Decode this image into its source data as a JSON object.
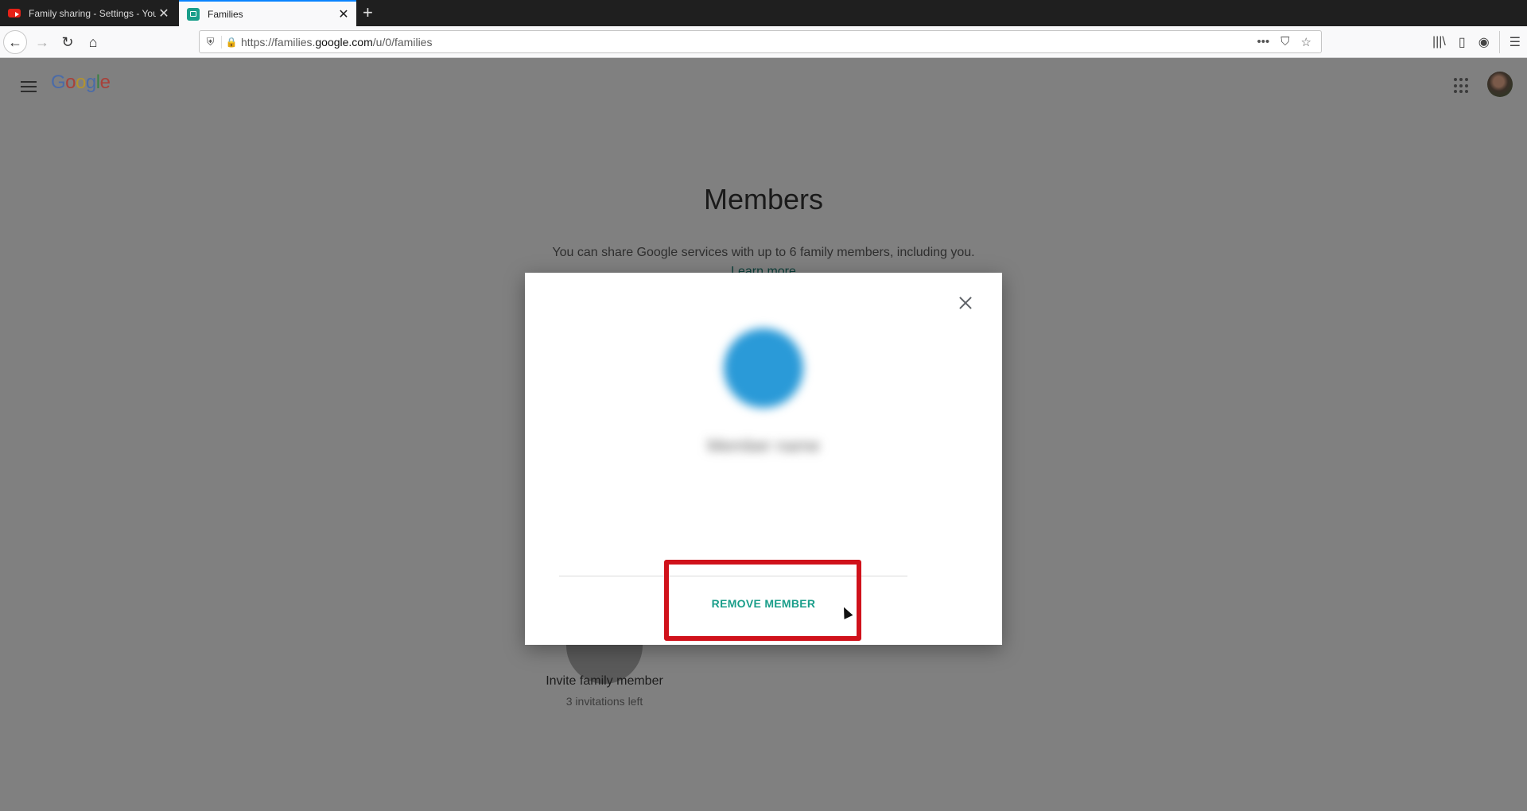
{
  "browser": {
    "tabs": [
      {
        "title": "Family sharing - Settings - YouTube",
        "favicon": "youtube-icon",
        "active": false
      },
      {
        "title": "Families",
        "favicon": "families-icon",
        "active": true
      }
    ],
    "new_tab_label": "+",
    "close_label": "✕",
    "url": {
      "prefix": "https://families.",
      "domain": "google.com",
      "path": "/u/0/families"
    },
    "nav": {
      "back": "←",
      "forward": "→",
      "reload": "↻",
      "home": "⌂"
    },
    "url_actions": {
      "more": "•••",
      "pocket": "⛉",
      "bookmark": "☆"
    },
    "toolbar": {
      "library": "|||\\",
      "sidebar": "▯",
      "account": "◉",
      "menu": "☰"
    }
  },
  "header": {
    "logo_letters": [
      {
        "ch": "G",
        "color": "#4a6ba8"
      },
      {
        "ch": "o",
        "color": "#a8413a"
      },
      {
        "ch": "o",
        "color": "#b3932f"
      },
      {
        "ch": "g",
        "color": "#4a6ba8"
      },
      {
        "ch": "l",
        "color": "#3b8046"
      },
      {
        "ch": "e",
        "color": "#a8413a"
      }
    ]
  },
  "main": {
    "title": "Members",
    "description": "You can share Google services with up to 6 family members, including you.",
    "learn_more": "Learn more",
    "invite": {
      "label": "Invite family member",
      "sub": "3 invitations left"
    }
  },
  "modal": {
    "member_name": "Member name",
    "remove_label": "REMOVE MEMBER",
    "accent_color": "#1a9e8a",
    "highlight_color": "#d0121b"
  }
}
